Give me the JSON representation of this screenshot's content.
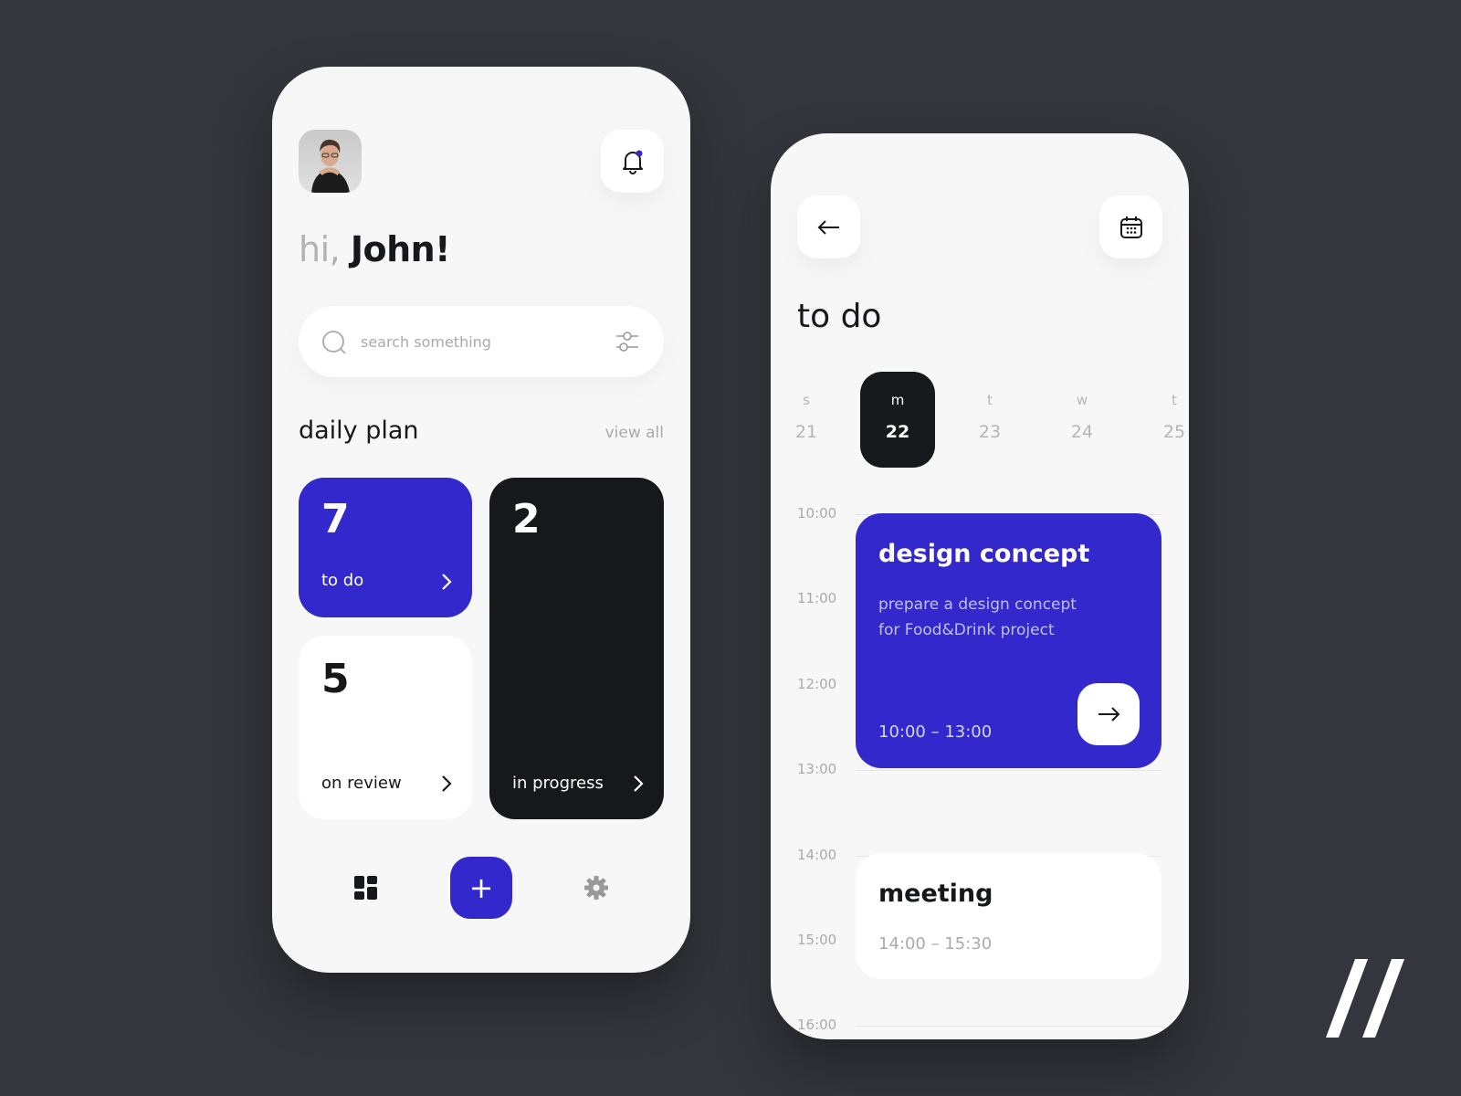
{
  "colors": {
    "accent": "#3228cc",
    "dark": "#17181c",
    "background": "#35363d",
    "surface": "#f7f7f7"
  },
  "home": {
    "greeting_prefix": "hi,",
    "greeting_name": "John!",
    "notification_dot": true,
    "search": {
      "placeholder": "search something"
    },
    "section_title": "daily plan",
    "view_all": "view all",
    "cards": [
      {
        "count": "7",
        "label": "to do"
      },
      {
        "count": "5",
        "label": "on review"
      },
      {
        "count": "2",
        "label": "in progress"
      }
    ],
    "nav": {
      "items": [
        "grid-icon",
        "plus-icon",
        "gear-icon"
      ],
      "plus_label": "+"
    }
  },
  "todo": {
    "title": "to do",
    "days": [
      {
        "letter": "s",
        "date": "21"
      },
      {
        "letter": "m",
        "date": "22",
        "selected": true
      },
      {
        "letter": "t",
        "date": "23"
      },
      {
        "letter": "w",
        "date": "24"
      },
      {
        "letter": "t",
        "date": "25"
      }
    ],
    "times": [
      "10:00",
      "11:00",
      "12:00",
      "13:00",
      "14:00",
      "15:00",
      "16:00"
    ],
    "events": [
      {
        "title": "design concept",
        "desc_line1": "prepare a design concept",
        "desc_line2": "for Food&Drink project",
        "time": "10:00 – 13:00"
      },
      {
        "title": "meeting",
        "time": "14:00 – 15:30"
      }
    ]
  }
}
